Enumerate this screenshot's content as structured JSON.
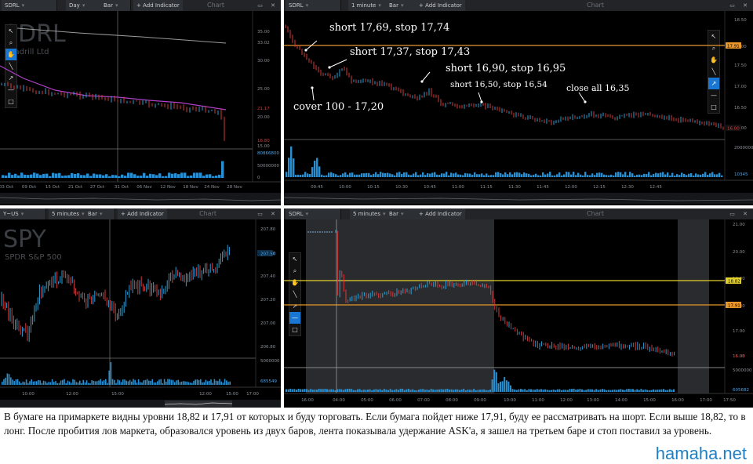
{
  "panels": {
    "p1": {
      "symbol": "SDRL",
      "name": "Seadrill Ltd",
      "timeframe": "Day",
      "style": "Bar",
      "add_indicator": "+ Add Indicator",
      "title": "Chart",
      "price_ticks": [
        "35.00",
        "33.02",
        "30.00",
        "25.00",
        "20.00",
        "15.00"
      ],
      "price_markers": [
        "21.17",
        "16.80"
      ],
      "vol_ticks": [
        "80866800",
        "50000000",
        "0"
      ],
      "dates": [
        "03 Oct",
        "09 Oct",
        "15 Oct",
        "21 Oct",
        "27 Oct",
        "31 Oct",
        "06 Nov",
        "12 Nov",
        "18 Nov",
        "24 Nov",
        "28 Nov"
      ]
    },
    "p2": {
      "symbol": "SDRL",
      "timeframe": "1 minute",
      "style": "Bar",
      "add_indicator": "+ Add Indicator",
      "title": "Chart",
      "price_ticks": [
        "18.50",
        "18.00",
        "17.50",
        "17.00",
        "16.50",
        "16.00"
      ],
      "price_markers": [
        "17.91",
        "16.00"
      ],
      "vol_ticks": [
        "2000000",
        "10345"
      ],
      "times": [
        "09:45",
        "10:00",
        "10:15",
        "10:30",
        "10:45",
        "11:00",
        "11:15",
        "11:30",
        "11:45",
        "12:00",
        "12:15",
        "12:30",
        "12:45"
      ],
      "annotations": [
        "short 17,69, stop 17,74",
        "short 17,37, stop 17,43",
        "short 16,90, stop 16,95",
        "short 16,50, stop 16,54",
        "close all 16,35",
        "cover 100 - 17,20"
      ]
    },
    "p3": {
      "symbol": "SPY",
      "name": "SPDR S&P 500",
      "symbol_tab": "Y~US",
      "timeframe": "5 minutes",
      "style": "Bar",
      "add_indicator": "+ Add Indicator",
      "title": "Chart",
      "price_ticks": [
        "207.80",
        "207.60",
        "207.40",
        "207.20",
        "207.00",
        "206.80"
      ],
      "price_markers": [
        "207.50"
      ],
      "vol_ticks": [
        "5000000",
        "685549"
      ],
      "times": [
        "10:00",
        "12:00",
        "15:00",
        "10:00",
        "12:00",
        "15:00",
        "17:00"
      ]
    },
    "p4": {
      "symbol": "SDRL",
      "timeframe": "5 minutes",
      "style": "Bar",
      "add_indicator": "+ Add Indicator",
      "title": "Chart",
      "price_ticks": [
        "21.00",
        "20.00",
        "19.00",
        "18.00",
        "17.00",
        "16.00"
      ],
      "price_markers": [
        "18.82",
        "17.91",
        "16.05"
      ],
      "vol_ticks": [
        "5000000",
        "605682"
      ],
      "times": [
        "16:00",
        "04:00",
        "05:00",
        "06:00",
        "07:00",
        "08:00",
        "09:00",
        "10:00",
        "11:00",
        "12:00",
        "13:00",
        "14:00",
        "15:00",
        "16:00",
        "17:00",
        "17:50"
      ]
    }
  },
  "caption": "В бумаге на примаркете видны уровни 18,82 и 17,91 от которых и буду торговать. Если бумага пойдет ниже 17,91, буду ее рассматривать на шорт. Если выше 18,82, то в лонг. После пробития лов маркета, образовался уровень из двух баров, лента показывала удержание ASK'а, я зашел на третьем баре и стоп поставил за уровень.",
  "brand": "hamaha.net",
  "colors": {
    "up": "#2a9fd6",
    "down": "#d23c3c",
    "volume": "#2a8fd0",
    "level_orange": "#e8952a",
    "level_yellow": "#e3d12b",
    "ma_purple": "#b040c8",
    "ma_white": "#d8d8d8"
  }
}
